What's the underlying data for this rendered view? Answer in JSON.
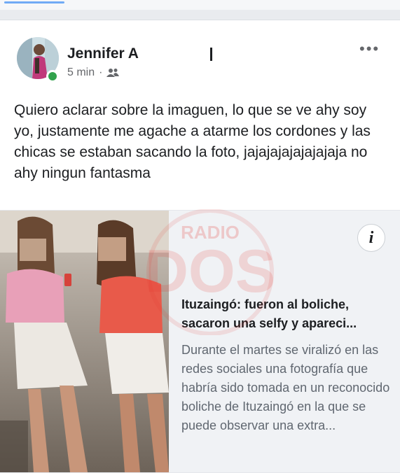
{
  "post": {
    "author_name": "Jennifer A",
    "redaction_mark": "I",
    "timestamp": "5 min",
    "dot": "·",
    "audience_icon": "friends-icon",
    "menu_icon": "more-options-icon",
    "menu_glyph": "•••",
    "message": "Quiero aclarar sobre la imaguen, lo que se ve ahy soy yo, justamente me agache a atarme los cordones y las chicas se estaban sacando la foto, jajajajajajajajaja no ahy ningun fantasma"
  },
  "link_preview": {
    "info_glyph": "i",
    "title": "Ituzaingó: fueron al boliche, sacaron una selfy y apareci...",
    "description": "Durante el martes se viralizó en las redes sociales una fotografía que habría sido tomada en un reconocido boliche de Ituzaingó en la que se puede observar una extra...",
    "watermark_text": "RADIO",
    "watermark_logo": "DOS"
  },
  "colors": {
    "online": "#31a24c",
    "accent": "#1877f2",
    "watermark": "#e5322d"
  }
}
